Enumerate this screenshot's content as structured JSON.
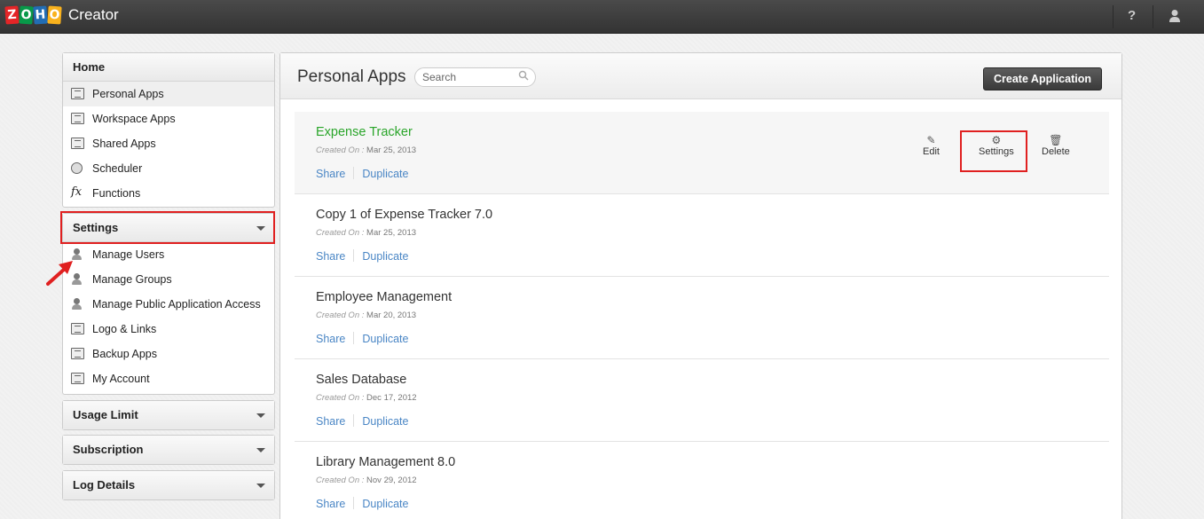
{
  "topbar": {
    "logo_letters": [
      "Z",
      "O",
      "H",
      "O"
    ],
    "product": "Creator",
    "help": "?"
  },
  "sidebar": {
    "home": {
      "title": "Home",
      "items": [
        {
          "label": "Personal Apps",
          "icon": "list-icon",
          "active": true
        },
        {
          "label": "Workspace Apps",
          "icon": "list-icon"
        },
        {
          "label": "Shared Apps",
          "icon": "list-icon"
        },
        {
          "label": "Scheduler",
          "icon": "clock-icon"
        },
        {
          "label": "Functions",
          "icon": "fx-icon",
          "glyph": "fx"
        }
      ]
    },
    "settings": {
      "title": "Settings",
      "items": [
        {
          "label": "Manage Users",
          "icon": "user-icon"
        },
        {
          "label": "Manage Groups",
          "icon": "group-icon"
        },
        {
          "label": "Manage Public Application Access",
          "icon": "user-icon"
        },
        {
          "label": "Logo & Links",
          "icon": "logo-icon"
        },
        {
          "label": "Backup Apps",
          "icon": "backup-icon"
        },
        {
          "label": "My Account",
          "icon": "account-icon"
        }
      ]
    },
    "usage_limit": "Usage Limit",
    "subscription": "Subscription",
    "log_details": "Log Details"
  },
  "main": {
    "title": "Personal Apps",
    "search_placeholder": "Search",
    "create_button": "Create Application",
    "created_prefix": "Created On :",
    "share_label": "Share",
    "duplicate_label": "Duplicate",
    "actions": {
      "edit": "Edit",
      "settings": "Settings",
      "delete": "Delete"
    },
    "apps": [
      {
        "name": "Expense Tracker",
        "date": "Mar 25, 2013"
      },
      {
        "name": "Copy 1 of Expense Tracker 7.0",
        "date": "Mar 25, 2013"
      },
      {
        "name": "Employee Management",
        "date": "Mar 20, 2013"
      },
      {
        "name": "Sales Database",
        "date": "Dec 17, 2012"
      },
      {
        "name": "Library Management 8.0",
        "date": "Nov 29, 2012"
      }
    ]
  },
  "colors": {
    "highlight": "#e02020",
    "app_name_active": "#2aa52a",
    "link": "#4a86c5"
  }
}
